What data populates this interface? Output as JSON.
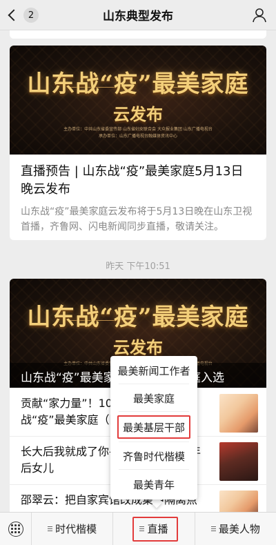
{
  "header": {
    "title": "山东典型发布",
    "back_count": "2"
  },
  "article1": {
    "banner_title": "山东战“疫”最美家庭",
    "banner_subtitle": "云发布",
    "banner_meta1": "主办单位：中共山东省委宣传部  山东省妇女联合会  大众报业集团  山东广播电视台",
    "banner_meta2": "承办单位：山东广播电视台融媒体资讯中心",
    "title": "直播预告 | 山东战“疫”最美家庭5月13日晚云发布",
    "description": "山东战“疫”最美家庭云发布将于5月13日晚在山东卫视首播，齐鲁网、闪电新闻同步直播，敬请关注。"
  },
  "timestamp": "昨天 下午10:51",
  "article2": {
    "banner_title": "山东战“疫”最美家庭",
    "banner_subtitle": "云发布",
    "banner_meta1": "主办单位：中共山东省委宣传部  山东省妇女联合会  大众报业集团  山东广播电视台",
    "overlay_title": "山东战“疫”最美家庭云发布  个家庭入选",
    "items": [
      {
        "text": "贡献“家力量”！10个家庭入选山东战“疫”最美家庭（附图）"
      },
      {
        "text": "长大后我就成了你——“非典”，17年后女儿"
      },
      {
        "text": "邵翠云：把自家宾馆改成集中隔离点"
      }
    ]
  },
  "popup": {
    "items": [
      {
        "label": "最美新闻工作者"
      },
      {
        "label": "最美家庭"
      },
      {
        "label": "最美基层干部"
      },
      {
        "label": "齐鲁时代楷模"
      },
      {
        "label": "最美青年"
      }
    ]
  },
  "bottom_menu": {
    "items": [
      {
        "label": "时代楷模"
      },
      {
        "label": "直播"
      },
      {
        "label": "最美人物"
      }
    ]
  },
  "colors": {
    "highlight": "#e23a3a",
    "gold": "#f3cf7a",
    "background": "#ededed"
  }
}
